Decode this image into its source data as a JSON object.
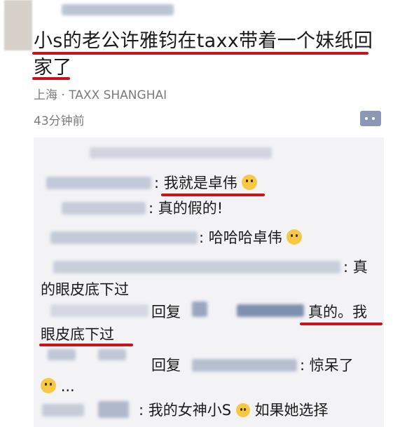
{
  "post": {
    "text_line1": "小s的老公许雅钧在taxx带着一个妹纸回",
    "text_line2": "家了",
    "location": "上海 · TAXX SHANGHAI",
    "time": "43分钟前"
  },
  "comments": [
    {
      "text": ": 我就是卓伟"
    },
    {
      "text": ": 真的假的!"
    },
    {
      "text": ": 哈哈哈卓伟"
    },
    {
      "text_a": ": 真",
      "text_b": "的眼皮底下过"
    },
    {
      "reply": "回复",
      "text_a": "真的。我",
      "text_b": "眼皮底下过"
    },
    {
      "reply": "回复",
      "text_a": ": 惊呆了",
      "text_b": "..."
    },
    {
      "text_a": ": 我的女神小S",
      "text_b": "如果她选择"
    }
  ],
  "colors": {
    "underline": "#c8131b",
    "meta_text": "#7a7a7a",
    "comments_bg": "#f3f3f5",
    "more_button": "#8c98b3"
  },
  "icons": [
    "more-options-icon",
    "smile-emoji-icon",
    "laugh-cry-emoji-icon",
    "shocked-emoji-icon",
    "scream-emoji-icon"
  ]
}
